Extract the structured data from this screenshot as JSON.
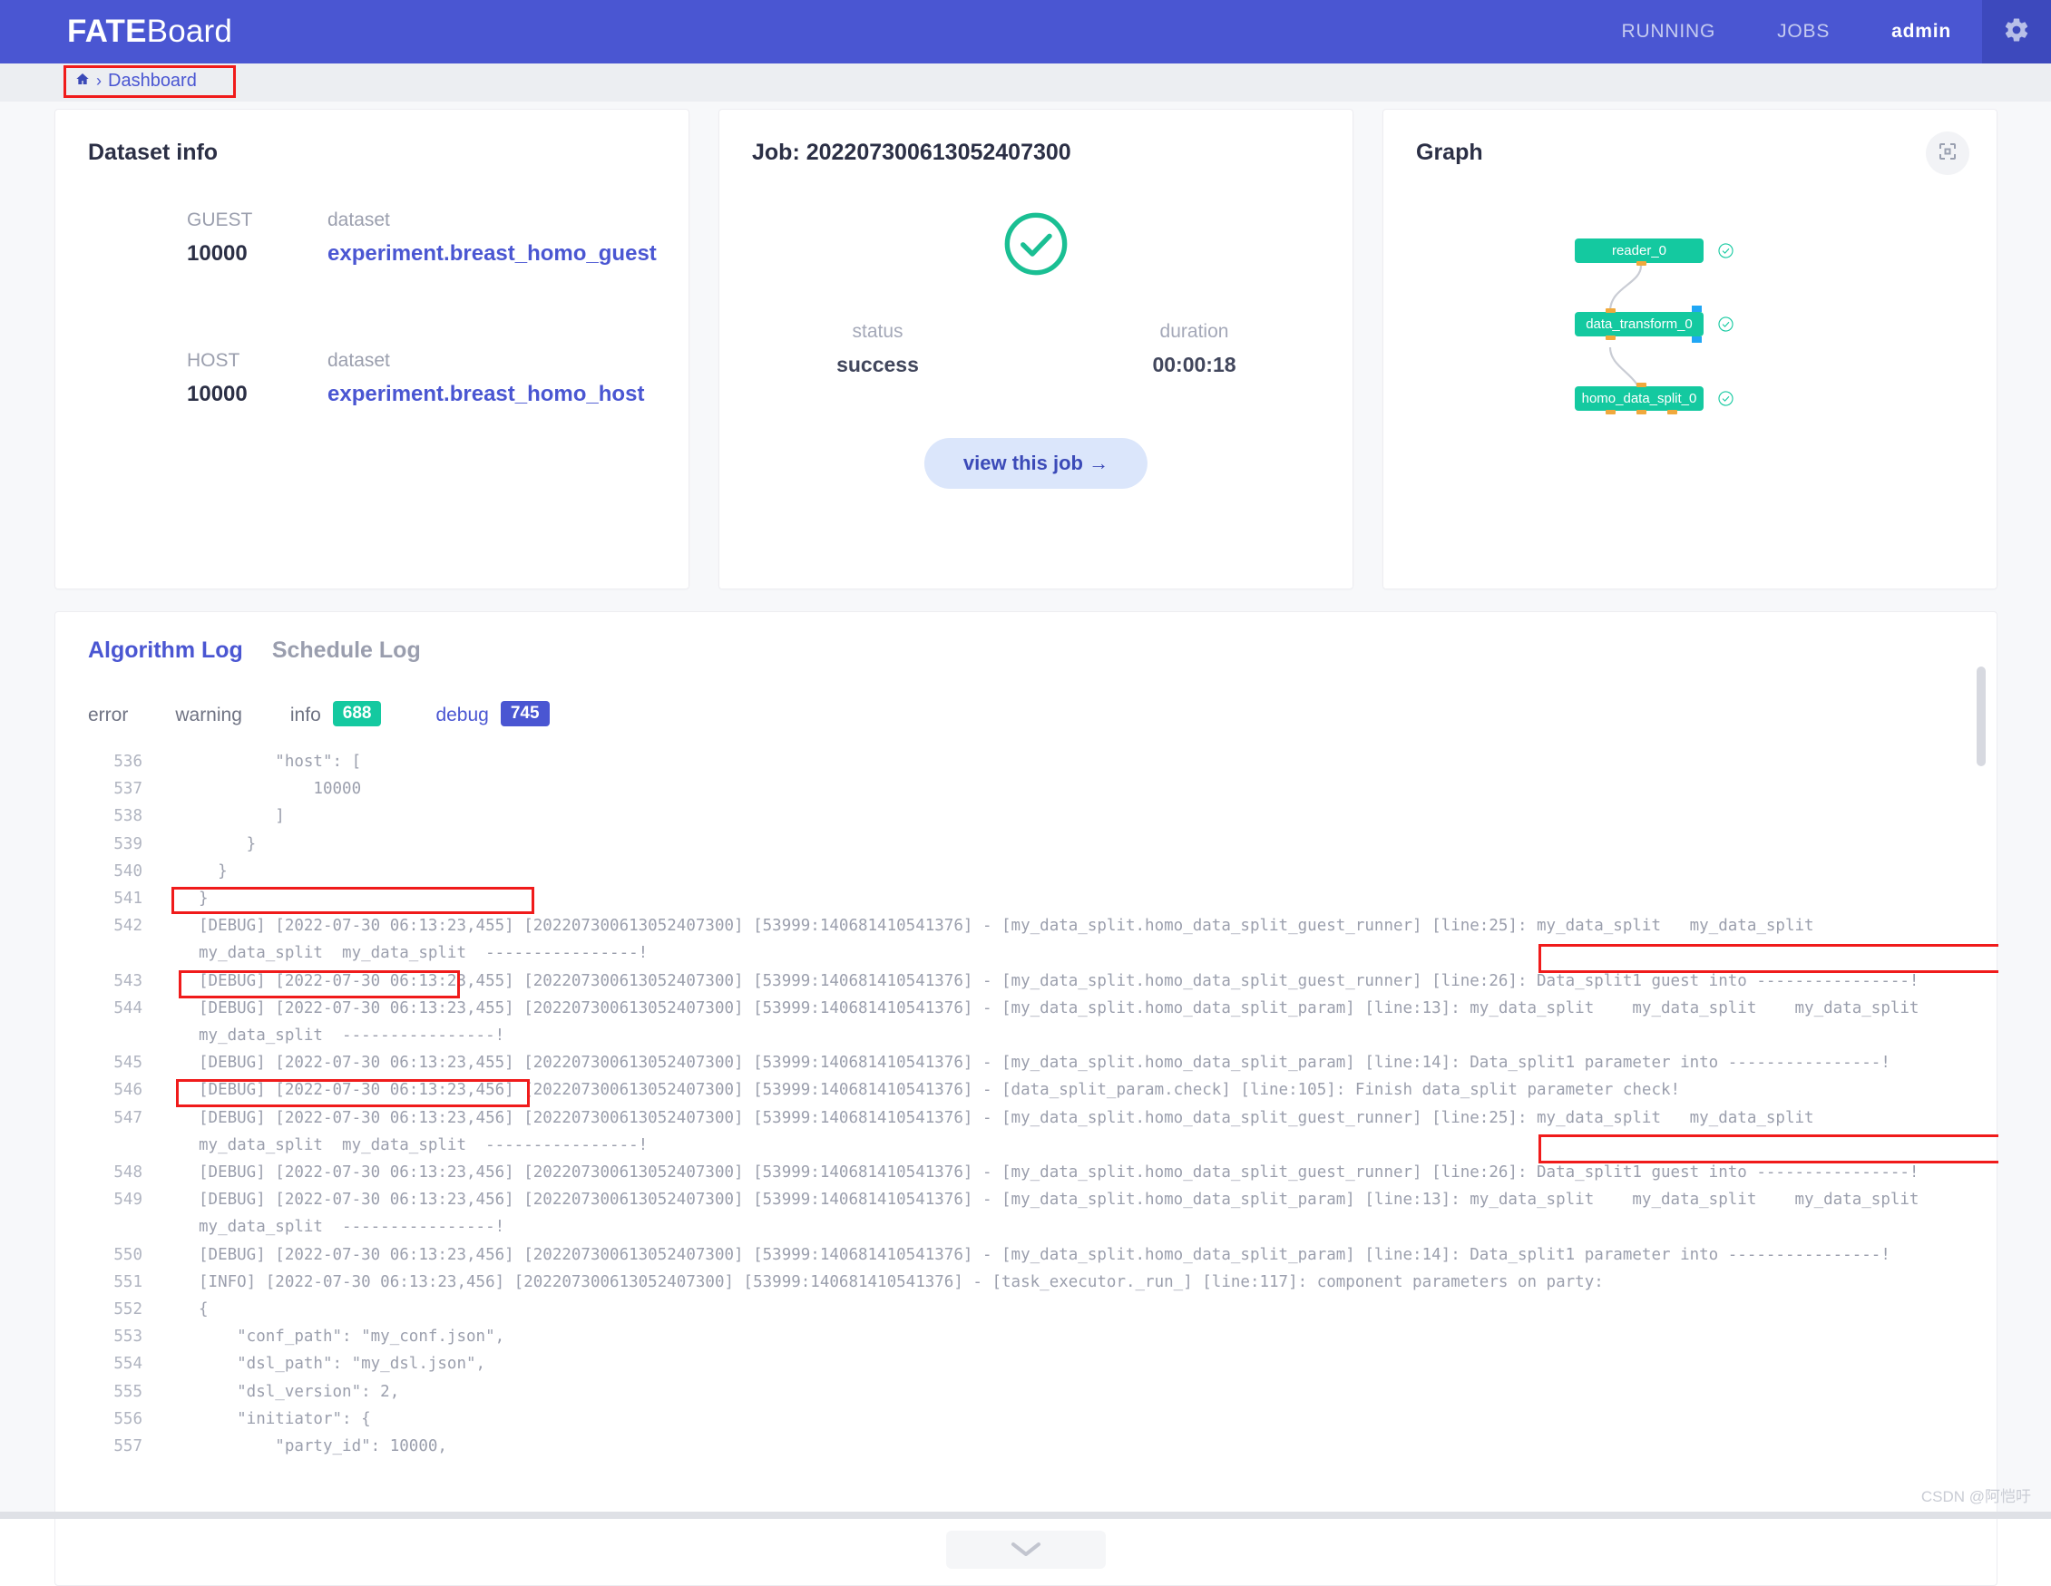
{
  "header": {
    "brand_bold": "FATE",
    "brand_rest": "Board",
    "nav": [
      {
        "label": "RUNNING",
        "active": false
      },
      {
        "label": "JOBS",
        "active": false
      },
      {
        "label": "admin",
        "active": true
      }
    ],
    "gear_icon": "gear-icon"
  },
  "breadcrumb": {
    "home_icon": "home-icon",
    "separator": "›",
    "label": "Dashboard"
  },
  "dataset_card": {
    "title": "Dataset info",
    "rows": [
      {
        "role_label": "GUEST",
        "role_value": "10000",
        "set_label": "dataset",
        "set_value": "experiment.breast_homo_guest"
      },
      {
        "role_label": "HOST",
        "role_value": "10000",
        "set_label": "dataset",
        "set_value": "experiment.breast_homo_host"
      }
    ]
  },
  "job_card": {
    "title": "Job: 202207300613052407300",
    "status_icon": "check-circle-icon",
    "status_label": "status",
    "status_value": "success",
    "duration_label": "duration",
    "duration_value": "00:00:18",
    "view_button": "view this job →"
  },
  "graph_card": {
    "title": "Graph",
    "fullscreen_icon": "fullscreen-icon",
    "nodes": [
      {
        "label": "reader_0",
        "status_icon": "check-circle-icon"
      },
      {
        "label": "data_transform_0",
        "status_icon": "check-circle-icon"
      },
      {
        "label": "homo_data_split_0",
        "status_icon": "check-circle-icon"
      }
    ]
  },
  "log_panel": {
    "tabs": [
      {
        "label": "Algorithm Log",
        "active": true
      },
      {
        "label": "Schedule Log",
        "active": false
      }
    ],
    "filters": [
      {
        "label": "error",
        "count": null
      },
      {
        "label": "warning",
        "count": null
      },
      {
        "label": "info",
        "count": "688"
      },
      {
        "label": "debug",
        "count": "745"
      }
    ],
    "badge_colors": {
      "info": "#14c9a0",
      "debug": "#4a56d2"
    },
    "collapse_icon": "chevron-down-icon",
    "lines": [
      {
        "no": "536",
        "text": "        \"host\": [",
        "wrap": null
      },
      {
        "no": "537",
        "text": "            10000",
        "wrap": null
      },
      {
        "no": "538",
        "text": "        ]",
        "wrap": null
      },
      {
        "no": "539",
        "text": "     }",
        "wrap": null
      },
      {
        "no": "540",
        "text": "  }",
        "wrap": null
      },
      {
        "no": "541",
        "text": "}",
        "wrap": null
      },
      {
        "no": "542",
        "text": "[DEBUG] [2022-07-30 06:13:23,455] [202207300613052407300] [53999:140681410541376] - [my_data_split.homo_data_split_guest_runner] [line:25]: my_data_split   my_data_split",
        "wrap": "my_data_split  my_data_split  ----------------!"
      },
      {
        "no": "543",
        "text": "[DEBUG] [2022-07-30 06:13:23,455] [202207300613052407300] [53999:140681410541376] - [my_data_split.homo_data_split_guest_runner] [line:26]: Data_split1 guest into ----------------!",
        "wrap": null
      },
      {
        "no": "544",
        "text": "[DEBUG] [2022-07-30 06:13:23,455] [202207300613052407300] [53999:140681410541376] - [my_data_split.homo_data_split_param] [line:13]: my_data_split    my_data_split    my_data_split",
        "wrap": "my_data_split  ----------------!"
      },
      {
        "no": "545",
        "text": "[DEBUG] [2022-07-30 06:13:23,455] [202207300613052407300] [53999:140681410541376] - [my_data_split.homo_data_split_param] [line:14]: Data_split1 parameter into ----------------!",
        "wrap": null
      },
      {
        "no": "546",
        "text": "[DEBUG] [2022-07-30 06:13:23,456] [202207300613052407300] [53999:140681410541376] - [data_split_param.check] [line:105]: Finish data_split parameter check!",
        "wrap": null
      },
      {
        "no": "547",
        "text": "[DEBUG] [2022-07-30 06:13:23,456] [202207300613052407300] [53999:140681410541376] - [my_data_split.homo_data_split_guest_runner] [line:25]: my_data_split   my_data_split",
        "wrap": "my_data_split  my_data_split  ----------------!"
      },
      {
        "no": "548",
        "text": "[DEBUG] [2022-07-30 06:13:23,456] [202207300613052407300] [53999:140681410541376] - [my_data_split.homo_data_split_guest_runner] [line:26]: Data_split1 guest into ----------------!",
        "wrap": null
      },
      {
        "no": "549",
        "text": "[DEBUG] [2022-07-30 06:13:23,456] [202207300613052407300] [53999:140681410541376] - [my_data_split.homo_data_split_param] [line:13]: my_data_split    my_data_split    my_data_split",
        "wrap": "my_data_split  ----------------!"
      },
      {
        "no": "550",
        "text": "[DEBUG] [2022-07-30 06:13:23,456] [202207300613052407300] [53999:140681410541376] - [my_data_split.homo_data_split_param] [line:14]: Data_split1 parameter into ----------------!",
        "wrap": null
      },
      {
        "no": "551",
        "text": "[INFO] [2022-07-30 06:13:23,456] [202207300613052407300] [53999:140681410541376] - [task_executor._run_] [line:117]: component parameters on party:",
        "wrap": null
      },
      {
        "no": "552",
        "text": "{",
        "wrap": null
      },
      {
        "no": "553",
        "text": "    \"conf_path\": \"my_conf.json\",",
        "wrap": null
      },
      {
        "no": "554",
        "text": "    \"dsl_path\": \"my_dsl.json\",",
        "wrap": null
      },
      {
        "no": "555",
        "text": "    \"dsl_version\": 2,",
        "wrap": null
      },
      {
        "no": "556",
        "text": "    \"initiator\": {",
        "wrap": null
      },
      {
        "no": "557",
        "text": "        \"party_id\": 10000,",
        "wrap": null
      }
    ]
  },
  "watermark": "CSDN @阿恺吁"
}
